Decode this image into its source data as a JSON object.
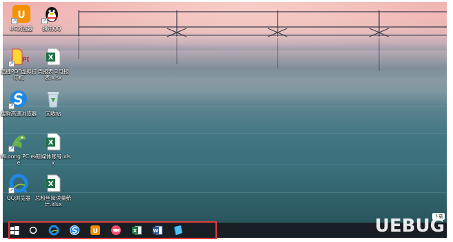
{
  "desktop": {
    "icons": [
      {
        "label": "UC浏览器",
        "icon": "uc-browser-icon"
      },
      {
        "label": "腾讯QQ",
        "icon": "qq-penguin-icon"
      },
      {
        "label": "迅捷PDF虚拟打印机",
        "icon": "pdf-printer-icon"
      },
      {
        "label": "周报表 2月报表.xlsx",
        "icon": "excel-file-icon"
      },
      {
        "label": "搜狗高速浏览器",
        "icon": "sogou-browser-icon"
      },
      {
        "label": "回收站",
        "icon": "recycle-bin-icon"
      },
      {
        "label": "MLoong PC.exe",
        "icon": "mloong-app-icon"
      },
      {
        "label": "新媒体账号.xlsx",
        "icon": "excel-file-icon"
      },
      {
        "label": "QQ浏览器",
        "icon": "qq-browser-icon"
      },
      {
        "label": "总粉丝阅读量统计.xlsx",
        "icon": "excel-file-icon"
      }
    ]
  },
  "taskbar": {
    "items": [
      {
        "name": "start",
        "icon": "windows-logo-icon"
      },
      {
        "name": "search",
        "icon": "search-circle-icon"
      },
      {
        "name": "qq-browser",
        "icon": "qq-browser-icon"
      },
      {
        "name": "sogou-browser",
        "icon": "sogou-browser-icon"
      },
      {
        "name": "uc-browser",
        "icon": "uc-browser-icon"
      },
      {
        "name": "screen-recorder",
        "icon": "recorder-icon"
      },
      {
        "name": "excel",
        "icon": "excel-icon"
      },
      {
        "name": "word",
        "icon": "word-icon"
      },
      {
        "name": "file-app",
        "icon": "book-icon"
      }
    ]
  },
  "watermark": {
    "brand": "UEBUG",
    "badge": "下载"
  },
  "colors": {
    "highlight": "#e23b3b",
    "excel": "#1e7145",
    "word": "#2b579a",
    "uc": "#f39200",
    "qq_blue": "#1e88e5"
  }
}
